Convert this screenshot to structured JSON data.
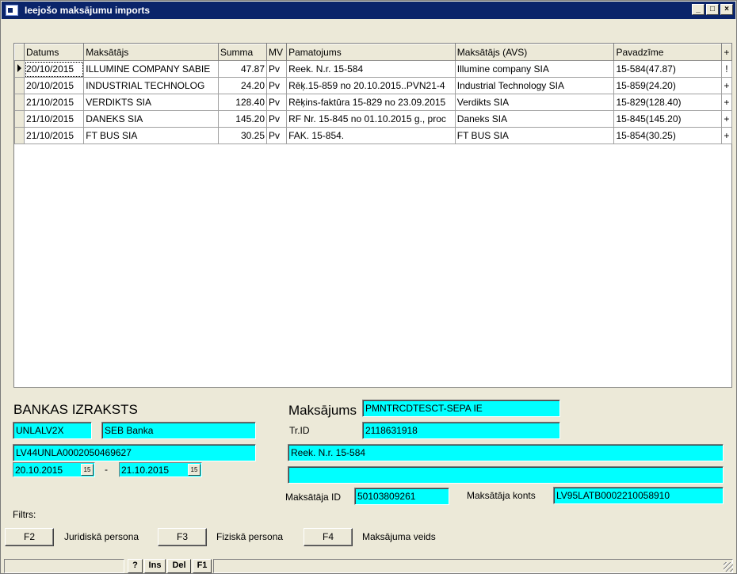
{
  "window": {
    "title": "Ieejošo maksājumu imports"
  },
  "grid": {
    "headers": [
      "Datums",
      "Maksātājs",
      "Summa",
      "MV",
      "Pamatojums",
      "Maksātājs (AVS)",
      "Pavadzīme",
      "+"
    ],
    "rows": [
      {
        "date": "20/10/2015",
        "payer": "ILLUMINE COMPANY SABIE",
        "sum": "47.87",
        "mv": "Pv",
        "basis": "Reek. N.r. 15-584",
        "payer_avs": "Illumine company SIA",
        "invoice": "15-584(47.87)",
        "flag": "!"
      },
      {
        "date": "20/10/2015",
        "payer": "INDUSTRIAL TECHNOLOG",
        "sum": "24.20",
        "mv": "Pv",
        "basis": "Rēķ.15-859 no 20.10.2015..PVN21-4",
        "payer_avs": "Industrial Technology SIA",
        "invoice": "15-859(24.20)",
        "flag": "+"
      },
      {
        "date": "21/10/2015",
        "payer": "VERDIKTS SIA",
        "sum": "128.40",
        "mv": "Pv",
        "basis": "Rēķins-faktūra 15-829 no 23.09.2015",
        "payer_avs": "Verdikts SIA",
        "invoice": "15-829(128.40)",
        "flag": "+"
      },
      {
        "date": "21/10/2015",
        "payer": "DANEKS SIA",
        "sum": "145.20",
        "mv": "Pv",
        "basis": "RF Nr. 15-845 no 01.10.2015 g., proc",
        "payer_avs": "Daneks SIA",
        "invoice": "15-845(145.20)",
        "flag": "+"
      },
      {
        "date": "21/10/2015",
        "payer": "FT BUS SIA",
        "sum": "30.25",
        "mv": "Pv",
        "basis": "FAK. 15-854.",
        "payer_avs": "FT BUS SIA",
        "invoice": "15-854(30.25)",
        "flag": "+"
      }
    ]
  },
  "bank": {
    "heading": "BANKAS IZRAKSTS",
    "bic": "UNLALV2X",
    "bank_name": "SEB Banka",
    "account": "LV44UNLA0002050469627",
    "date_from": "20.10.2015",
    "date_separator": "-",
    "date_to": "21.10.2015",
    "cal_icon_text": "15"
  },
  "payment": {
    "heading": "Maksājums",
    "type": "PMNTRCDTESCT-SEPA IE",
    "trid_label": "Tr.ID",
    "trid": "2118631918",
    "basis": "Reek. N.r. 15-584",
    "basis2": "",
    "payer_id_label": "Maksātāja ID",
    "payer_id": "50103809261",
    "payer_account_label": "Maksātāja konts",
    "payer_account": "LV95LATB0002210058910"
  },
  "filter": {
    "label": "Filtrs:",
    "f2": "F2",
    "f2_label": "Juridiskā persona",
    "f3": "F3",
    "f3_label": "Fiziskā persona",
    "f4": "F4",
    "f4_label": "Maksājuma veids"
  },
  "statusbar": {
    "help": "?",
    "ins": "Ins",
    "del": "Del",
    "f1": "F1"
  }
}
